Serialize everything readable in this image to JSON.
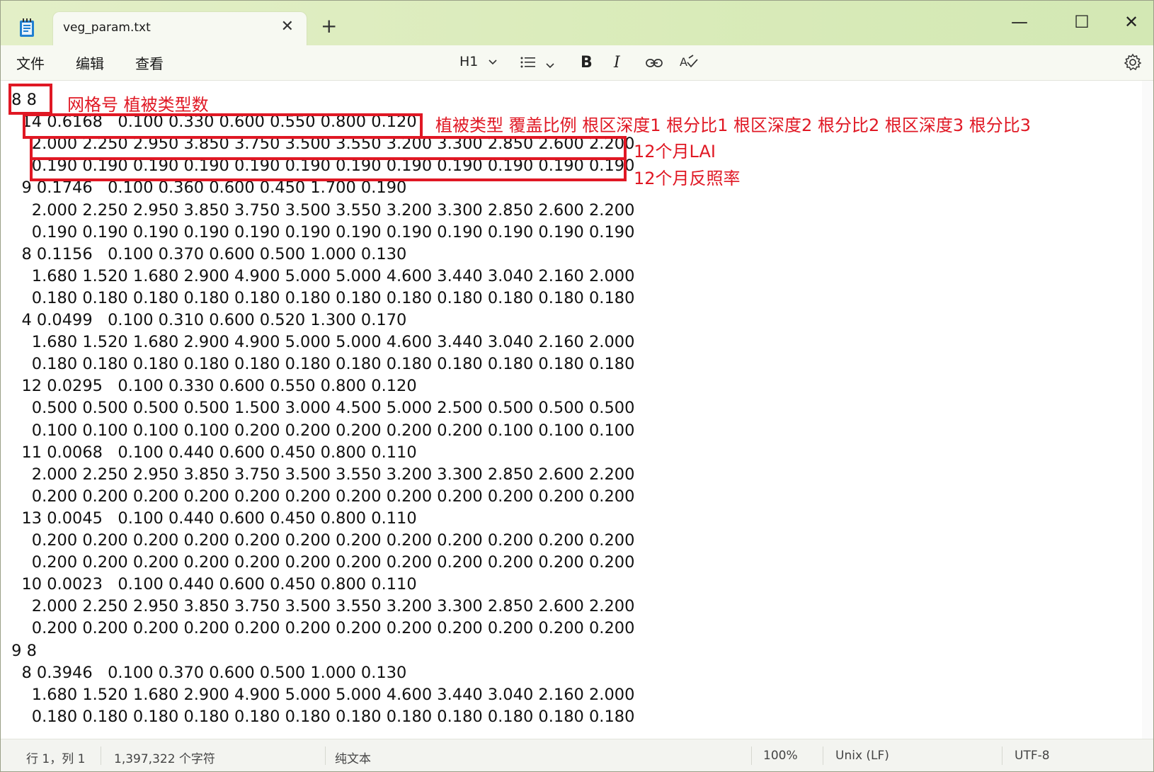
{
  "window": {
    "tab_title": "veg_param.txt",
    "close_tab_glyph": "✕",
    "new_tab_glyph": "+",
    "minimize_glyph": "—",
    "maximize_glyph": "☐",
    "close_glyph": "✕",
    "app_icon": "notepad-icon"
  },
  "menu": {
    "file": "文件",
    "edit": "编辑",
    "view": "查看"
  },
  "format_toolbar": {
    "heading": "H1",
    "bold": "B",
    "italic": "I",
    "list_icon": "list-icon",
    "link_icon": "link-icon",
    "spell_icon": "spellcheck-icon",
    "settings_icon": "gear-icon"
  },
  "editor_lines": [
    " 8 8",
    "   14 0.6168   0.100 0.330 0.600 0.550 0.800 0.120",
    "     2.000 2.250 2.950 3.850 3.750 3.500 3.550 3.200 3.300 2.850 2.600 2.200",
    "     0.190 0.190 0.190 0.190 0.190 0.190 0.190 0.190 0.190 0.190 0.190 0.190",
    "   9 0.1746   0.100 0.360 0.600 0.450 1.700 0.190",
    "     2.000 2.250 2.950 3.850 3.750 3.500 3.550 3.200 3.300 2.850 2.600 2.200",
    "     0.190 0.190 0.190 0.190 0.190 0.190 0.190 0.190 0.190 0.190 0.190 0.190",
    "   8 0.1156   0.100 0.370 0.600 0.500 1.000 0.130",
    "     1.680 1.520 1.680 2.900 4.900 5.000 5.000 4.600 3.440 3.040 2.160 2.000",
    "     0.180 0.180 0.180 0.180 0.180 0.180 0.180 0.180 0.180 0.180 0.180 0.180",
    "   4 0.0499   0.100 0.310 0.600 0.520 1.300 0.170",
    "     1.680 1.520 1.680 2.900 4.900 5.000 5.000 4.600 3.440 3.040 2.160 2.000",
    "     0.180 0.180 0.180 0.180 0.180 0.180 0.180 0.180 0.180 0.180 0.180 0.180",
    "   12 0.0295   0.100 0.330 0.600 0.550 0.800 0.120",
    "     0.500 0.500 0.500 0.500 1.500 3.000 4.500 5.000 2.500 0.500 0.500 0.500",
    "     0.100 0.100 0.100 0.100 0.200 0.200 0.200 0.200 0.200 0.100 0.100 0.100",
    "   11 0.0068   0.100 0.440 0.600 0.450 0.800 0.110",
    "     2.000 2.250 2.950 3.850 3.750 3.500 3.550 3.200 3.300 2.850 2.600 2.200",
    "     0.200 0.200 0.200 0.200 0.200 0.200 0.200 0.200 0.200 0.200 0.200 0.200",
    "   13 0.0045   0.100 0.440 0.600 0.450 0.800 0.110",
    "     0.200 0.200 0.200 0.200 0.200 0.200 0.200 0.200 0.200 0.200 0.200 0.200",
    "     0.200 0.200 0.200 0.200 0.200 0.200 0.200 0.200 0.200 0.200 0.200 0.200",
    "   10 0.0023   0.100 0.440 0.600 0.450 0.800 0.110",
    "     2.000 2.250 2.950 3.850 3.750 3.500 3.550 3.200 3.300 2.850 2.600 2.200",
    "     0.200 0.200 0.200 0.200 0.200 0.200 0.200 0.200 0.200 0.200 0.200 0.200",
    " 9 8",
    "   8 0.3946   0.100 0.370 0.600 0.500 1.000 0.130",
    "     1.680 1.520 1.680 2.900 4.900 5.000 5.000 4.600 3.440 3.040 2.160 2.000",
    "     0.180 0.180 0.180 0.180 0.180 0.180 0.180 0.180 0.180 0.180 0.180 0.180"
  ],
  "annotations": {
    "grid_header": "网格号 植被类型数",
    "veg_header": "植被类型 覆盖比例 根区深度1 根分比1 根区深度2 根分比2 根区深度3 根分比3",
    "lai": "12个月LAI",
    "albedo": "12个月反照率",
    "color": "#e01824"
  },
  "status": {
    "position": "行 1，列 1",
    "chars": "1,397,322 个字符",
    "format": "纯文本",
    "zoom": "100%",
    "eol": "Unix (LF)",
    "encoding": "UTF-8"
  }
}
